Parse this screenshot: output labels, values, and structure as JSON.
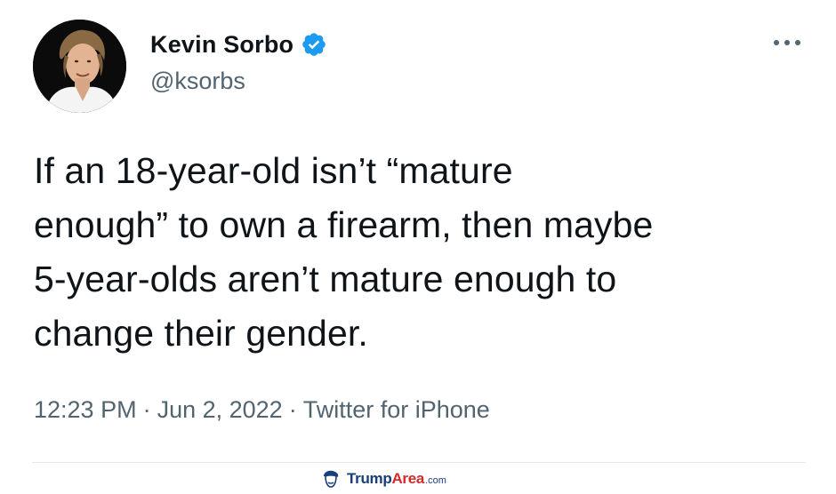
{
  "user": {
    "display_name": "Kevin Sorbo",
    "handle": "@ksorbs",
    "verified": true
  },
  "icons": {
    "verified": "verified-badge-icon",
    "more": "more-options-icon"
  },
  "tweet": {
    "lines": [
      "If an 18-year-old isn’t “mature",
      "enough” to own a firearm, then maybe",
      "5-year-olds aren’t mature enough to",
      "change their gender."
    ]
  },
  "meta": {
    "time": "12:23 PM",
    "separator": "·",
    "date": "Jun 2, 2022",
    "source": "Twitter for iPhone"
  },
  "watermark": {
    "brand_primary": "Trump",
    "brand_accent": "Area",
    "domain": ".com"
  },
  "colors": {
    "verified_blue": "#1d9bf0",
    "text": "#0f1419",
    "secondary_text": "#536471",
    "divider": "#e4e8eb"
  }
}
